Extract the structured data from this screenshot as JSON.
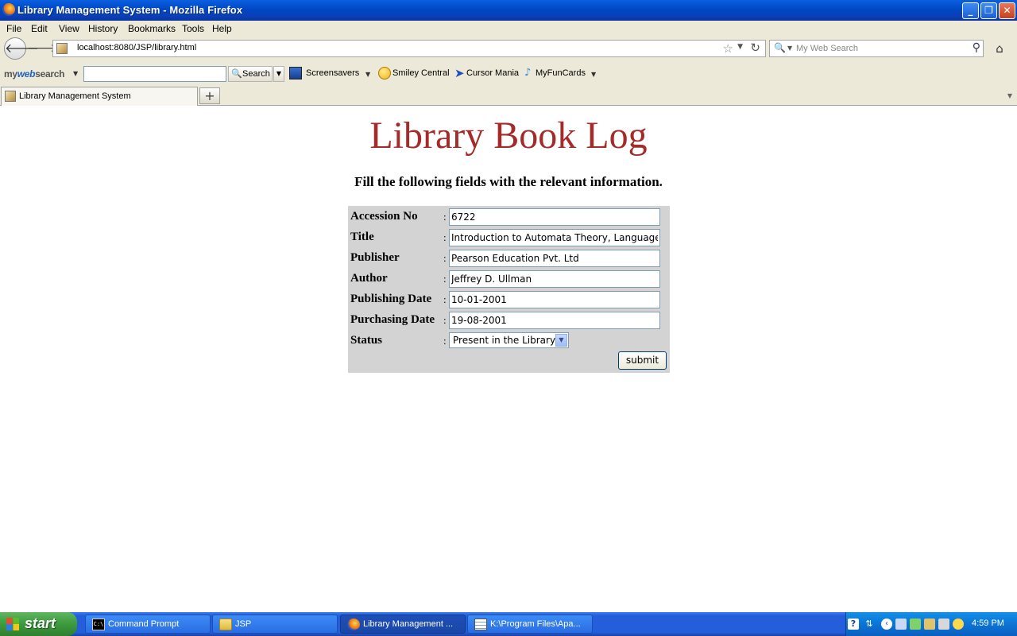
{
  "window": {
    "title": "Library Management System - Mozilla Firefox",
    "minimize": "_",
    "restore": "❐",
    "close": "✕"
  },
  "menu": [
    {
      "label": "File"
    },
    {
      "label": "Edit"
    },
    {
      "label": "View"
    },
    {
      "label": "History"
    },
    {
      "label": "Bookmarks"
    },
    {
      "label": "Tools"
    },
    {
      "label": "Help"
    }
  ],
  "nav": {
    "url": "localhost:8080/JSP/library.html",
    "search_placeholder": "My Web Search"
  },
  "toolbar": {
    "logo_my": "my",
    "logo_web": "web",
    "logo_search": "search",
    "search_button": "Search",
    "screensavers": "Screensavers",
    "smiley": "Smiley Central",
    "cursor": "Cursor Mania",
    "cards": "MyFunCards"
  },
  "tabs": [
    {
      "label": "Library Management System"
    }
  ],
  "page": {
    "title": "Library Book Log",
    "instructions": "Fill the following fields with the relevant information.",
    "colon": ":",
    "fields": {
      "accession_no": {
        "label": "Accession No",
        "value": "6722"
      },
      "title": {
        "label": "Title",
        "value": "Introduction to Automata Theory, Languages"
      },
      "publisher": {
        "label": "Publisher",
        "value": "Pearson Education Pvt. Ltd"
      },
      "author": {
        "label": "Author",
        "value": "Jeffrey D. Ullman"
      },
      "publishing_date": {
        "label": "Publishing Date",
        "value": "10-01-2001"
      },
      "purchasing_date": {
        "label": "Purchasing Date",
        "value": "19-08-2001"
      },
      "status": {
        "label": "Status",
        "value": "Present in the Library"
      }
    },
    "submit": "submit"
  },
  "taskbar": {
    "start": "start",
    "tasks": [
      {
        "label": "Command Prompt"
      },
      {
        "label": "JSP"
      },
      {
        "label": "Library Management ..."
      },
      {
        "label": "K:\\Program Files\\Apa..."
      }
    ],
    "clock": "4:59 PM",
    "cmd_icon_text": "C:\\"
  },
  "colors": {
    "title_color": "#a52a2a",
    "form_bg": "#d3d3d3"
  }
}
